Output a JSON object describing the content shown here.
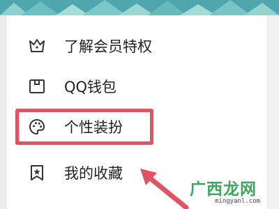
{
  "menu": {
    "items": [
      {
        "label": "了解会员特权",
        "icon": "crown-icon"
      },
      {
        "label": "QQ钱包",
        "icon": "wallet-icon"
      },
      {
        "label": "个性装扮",
        "icon": "palette-icon"
      },
      {
        "label": "我的收藏",
        "icon": "bookmark-star-icon"
      }
    ]
  },
  "annotation": {
    "highlight_color": "#e05363",
    "highlighted_item": "个性装扮"
  },
  "watermark": {
    "text": "广西龙网",
    "url": "mingyanl.com"
  },
  "colors": {
    "banner": "#5fb3b8",
    "icon": "#333333"
  }
}
